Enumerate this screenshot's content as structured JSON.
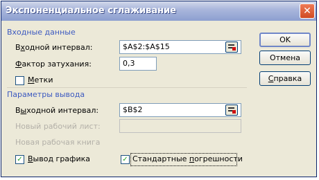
{
  "title": "Экспоненциальное сглаживание",
  "close_glyph": "✕",
  "input_section": {
    "heading": "Входные данные",
    "input_range": {
      "label_pre": "В",
      "label_u": "х",
      "label_post": "одной интервал:",
      "value": "$A$2:$A$15"
    },
    "damping": {
      "label_u": "Ф",
      "label_post": "актор затухания:",
      "value": "0,3"
    },
    "labels_checkbox": {
      "label_u": "М",
      "label_post": "етки",
      "checked": false,
      "mark": ""
    }
  },
  "output_section": {
    "heading": "Параметры вывода",
    "output_range": {
      "label_pre": "В",
      "label_u": "ы",
      "label_post": "ходной интервал:",
      "value": "$B$2"
    },
    "new_sheet": {
      "label": "Новый рабочий лист:",
      "value": ""
    },
    "new_book": {
      "label": "Новая рабочая книга"
    },
    "chart_output": {
      "label_u": "В",
      "label_post": "ывод графика",
      "checked": true,
      "mark": "✓"
    },
    "std_errors": {
      "label_pre": "Стандартные ",
      "label_u": "п",
      "label_post": "огрешности",
      "checked": true,
      "mark": "✓"
    }
  },
  "buttons": {
    "ok": "OK",
    "cancel": "Отмена",
    "help_u": "С",
    "help_post": "правка"
  },
  "icons": {
    "range_select": "range-select-icon",
    "check": "checkmark-icon"
  },
  "colors": {
    "section_heading": "#3c59c0",
    "titlebar": "#aab7dc",
    "close": "#d04a22"
  }
}
